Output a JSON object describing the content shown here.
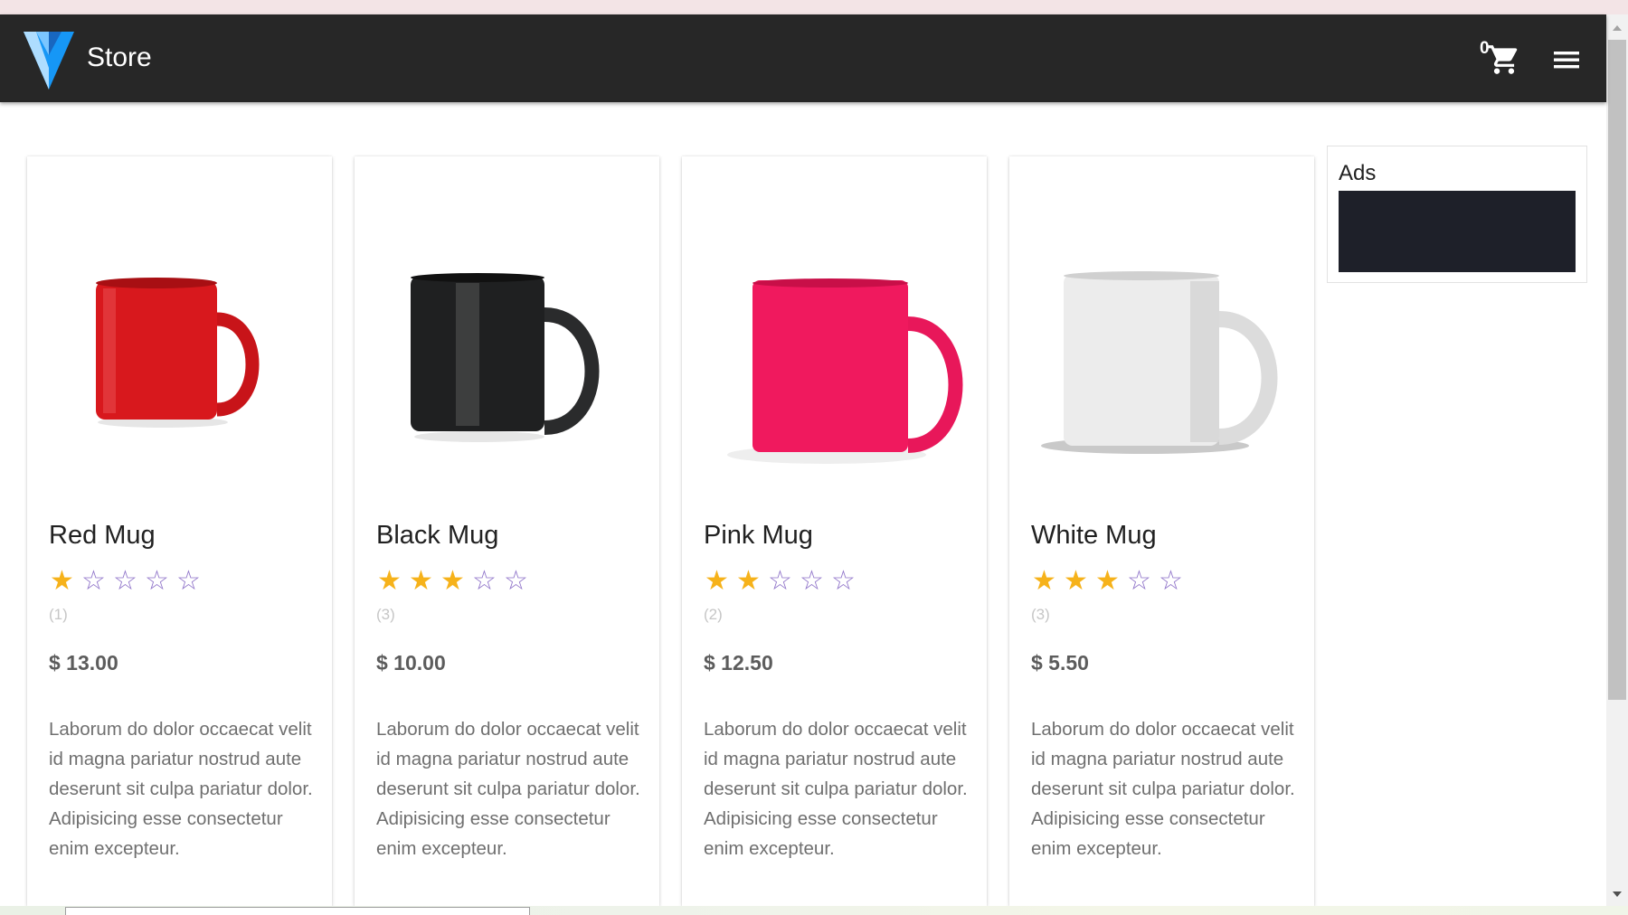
{
  "app": {
    "brand": "Store",
    "cart_count": "0"
  },
  "products": [
    {
      "name": "Red Mug",
      "rating": 1,
      "max_rating": 5,
      "review_count": "(1)",
      "price": "$ 13.00",
      "description": "Laborum do dolor occaecat velit id magna pariatur nostrud aute deserunt sit culpa pariatur dolor. Adipisicing esse consectetur enim excepteur.",
      "mug_color": "#d8181d"
    },
    {
      "name": "Black Mug",
      "rating": 3,
      "max_rating": 5,
      "review_count": "(3)",
      "price": "$ 10.00",
      "description": "Laborum do dolor occaecat velit id magna pariatur nostrud aute deserunt sit culpa pariatur dolor. Adipisicing esse consectetur enim excepteur.",
      "mug_color": "#1f2021"
    },
    {
      "name": "Pink Mug",
      "rating": 2,
      "max_rating": 5,
      "review_count": "(2)",
      "price": "$ 12.50",
      "description": "Laborum do dolor occaecat velit id magna pariatur nostrud aute deserunt sit culpa pariatur dolor. Adipisicing esse consectetur enim excepteur.",
      "mug_color": "#f0195e"
    },
    {
      "name": "White Mug",
      "rating": 3,
      "max_rating": 5,
      "review_count": "(3)",
      "price": "$ 5.50",
      "description": "Laborum do dolor occaecat velit id magna pariatur nostrud aute deserunt sit culpa pariatur dolor. Adipisicing esse consectetur enim excepteur.",
      "mug_color": "#ececec"
    }
  ],
  "ads": {
    "label": "Ads"
  },
  "icons": {
    "logo": "vuetify-logo",
    "cart": "cart-icon",
    "menu": "menu-icon",
    "star_full": "star-icon",
    "star_empty": "star-outline-icon"
  },
  "colors": {
    "appbar": "#272727",
    "star_full": "#f6b21a",
    "star_empty": "#8f73c9",
    "ad_block": "#1e2029"
  }
}
